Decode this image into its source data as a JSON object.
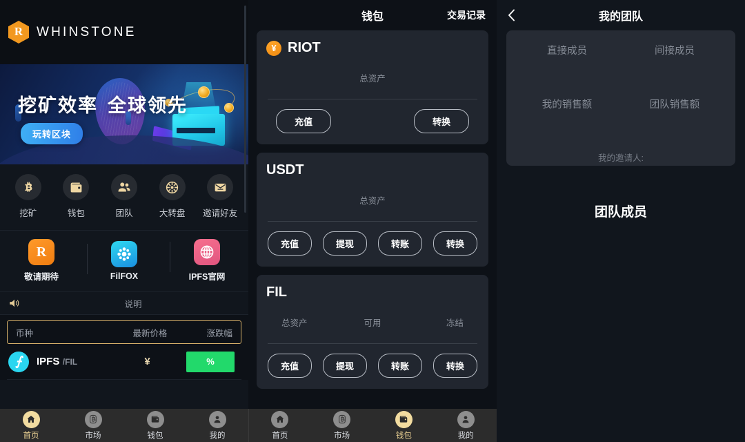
{
  "home": {
    "brand": {
      "mark": "R",
      "name": "WHINSTONE",
      "icon": "whinstone-logo-icon"
    },
    "banner": {
      "title_part1": "挖矿效率",
      "title_part2": "全球领先",
      "badge": "玩转区块"
    },
    "quick_items": [
      {
        "label": "挖矿",
        "icon": "bitcoin-icon"
      },
      {
        "label": "钱包",
        "icon": "wallet-icon"
      },
      {
        "label": "团队",
        "icon": "people-icon"
      },
      {
        "label": "大转盘",
        "icon": "wheel-icon"
      },
      {
        "label": "邀请好友",
        "icon": "mail-icon"
      }
    ],
    "apps": [
      {
        "label": "敬请期待",
        "icon": "riot-app-icon",
        "glyph": "R"
      },
      {
        "label": "FilFOX",
        "icon": "filfox-app-icon",
        "glyph": ""
      },
      {
        "label": "IPFS官网",
        "icon": "globe-app-icon",
        "glyph": ""
      }
    ],
    "notice": {
      "icon": "speaker-icon",
      "text": "说明"
    },
    "price_table": {
      "headers": [
        "币种",
        "最新价格",
        "涨跌幅"
      ],
      "rows": [
        {
          "icon": "filecoin-icon",
          "symbol": "IPFS",
          "pair": "/FIL",
          "price": "¥",
          "change": "%",
          "change_color": "#22d96b"
        }
      ]
    }
  },
  "wallet": {
    "title": "钱包",
    "record_label": "交易记录",
    "cards": [
      {
        "name": "RIOT",
        "has_coin_icon": true,
        "coin_glyph": "¥",
        "stats": [
          "总资产"
        ],
        "actions": [
          "充值",
          "转换"
        ]
      },
      {
        "name": "USDT",
        "has_coin_icon": false,
        "coin_glyph": "",
        "stats": [
          "总资产"
        ],
        "actions": [
          "充值",
          "提现",
          "转账",
          "转换"
        ]
      },
      {
        "name": "FIL",
        "has_coin_icon": false,
        "coin_glyph": "",
        "stats": [
          "总资产",
          "可用",
          "冻结"
        ],
        "actions": [
          "充值",
          "提现",
          "转账",
          "转换"
        ]
      }
    ]
  },
  "team": {
    "back_icon": "chevron-left-icon",
    "title": "我的团队",
    "cells": [
      "直接成员",
      "间接成员",
      "我的销售额",
      "团队销售额"
    ],
    "inviter_label": "我的邀请人:",
    "members_title": "团队成员"
  },
  "tabbars": [
    {
      "tabs": [
        {
          "label": "首页",
          "icon": "home-icon",
          "active": true
        },
        {
          "label": "市场",
          "icon": "market-icon",
          "active": false
        },
        {
          "label": "钱包",
          "icon": "wallet-icon",
          "active": false
        },
        {
          "label": "我的",
          "icon": "person-icon",
          "active": false
        }
      ]
    },
    {
      "tabs": [
        {
          "label": "首页",
          "icon": "home-icon",
          "active": false
        },
        {
          "label": "市场",
          "icon": "market-icon",
          "active": false
        },
        {
          "label": "钱包",
          "icon": "wallet-icon",
          "active": true
        },
        {
          "label": "我的",
          "icon": "person-icon",
          "active": false
        }
      ]
    }
  ],
  "colors": {
    "accent_gold": "#e8cf92",
    "brand_orange": "#f2981f",
    "up_green": "#22d96b",
    "card_bg": "#21262f",
    "page_bg": "#0d1117"
  }
}
